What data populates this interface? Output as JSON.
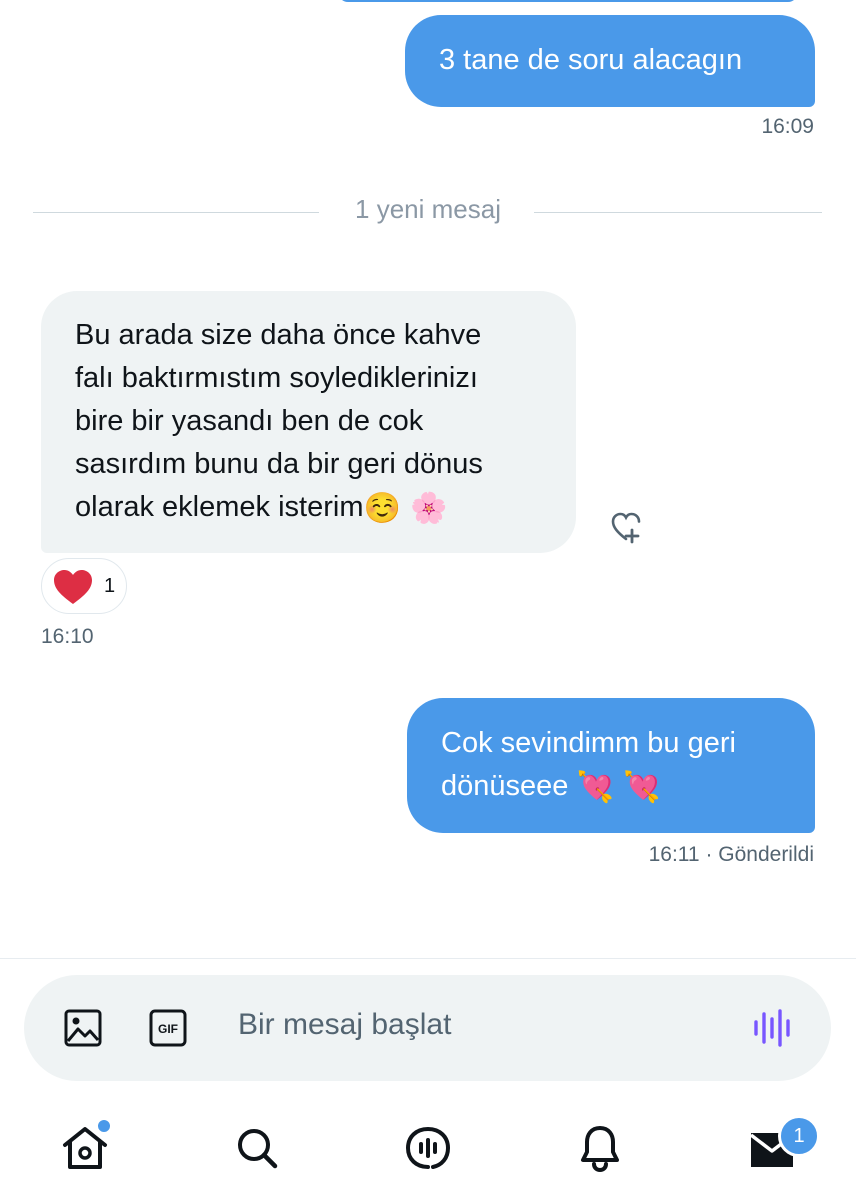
{
  "messages": [
    {
      "direction": "outgoing",
      "text": "3 tane de soru alacagın",
      "time": "16:09"
    },
    {
      "direction": "incoming",
      "lines": [
        "Bu arada size daha önce kahve",
        "falı baktırmıstım soylediklerinizı",
        "bire bir yasandı ben de cok",
        "sasırdım bunu da bir geri dönus",
        "olarak eklemek isterim"
      ],
      "emoji": "☺️ 🌸",
      "reaction_count": "1",
      "time": "16:10"
    },
    {
      "direction": "outgoing",
      "lines": [
        "Cok sevindimm bu geri",
        "dönüseee"
      ],
      "emoji": "💘 💘",
      "time": "16:11",
      "status": "· Gönderildi"
    }
  ],
  "divider": {
    "label": "1 yeni mesaj"
  },
  "composer": {
    "placeholder": "Bir mesaj başlat"
  },
  "nav": {
    "messages_badge": "1"
  },
  "colors": {
    "accent": "#4a99e9",
    "incoming_bg": "#eff3f4",
    "reaction": "#e0245e",
    "voice": "#7856ff"
  },
  "icons": [
    "image-icon",
    "gif-icon",
    "voice-icon",
    "home-icon",
    "search-icon",
    "spaces-icon",
    "bell-icon",
    "mail-icon",
    "heart-plus-icon"
  ]
}
